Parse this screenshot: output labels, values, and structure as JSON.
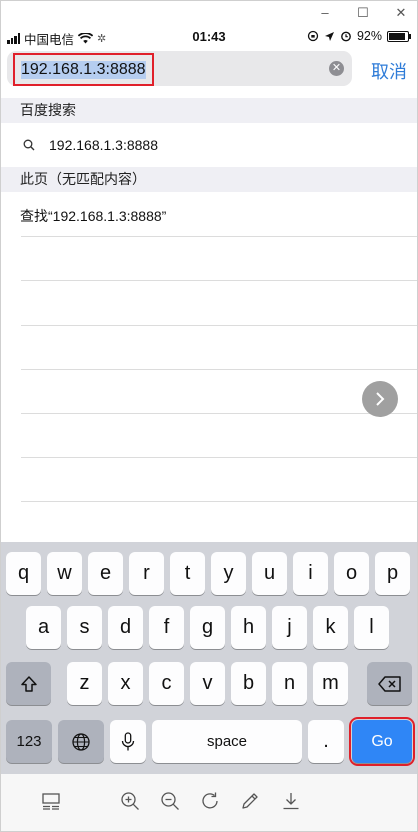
{
  "status_bar": {
    "carrier": "中国电信",
    "time": "01:43",
    "battery": "92%"
  },
  "address_bar": {
    "url": "192.168.1.3:8888",
    "cancel_label": "取消"
  },
  "suggestions": {
    "section_baidu": "百度搜索",
    "baidu_item": "192.168.1.3:8888",
    "section_page": "此页（无匹配内容）",
    "find_item": "查找“192.168.1.3:8888”"
  },
  "keyboard": {
    "row1": [
      "q",
      "w",
      "e",
      "r",
      "t",
      "y",
      "u",
      "i",
      "o",
      "p"
    ],
    "row2": [
      "a",
      "s",
      "d",
      "f",
      "g",
      "h",
      "j",
      "k",
      "l"
    ],
    "row3": [
      "z",
      "x",
      "c",
      "v",
      "b",
      "n",
      "m"
    ],
    "numbers_label": "123",
    "space_label": "space",
    "period_label": ".",
    "go_label": "Go"
  },
  "icons": {
    "window": [
      "minimize-icon",
      "maximize-icon",
      "close-icon"
    ],
    "toolbar": [
      "layout-icon",
      "zoom-in-icon",
      "zoom-out-icon",
      "rotate-icon",
      "edit-icon",
      "download-icon"
    ]
  },
  "colors": {
    "accent": "#2f7cd8",
    "go_key": "#2f86f6",
    "highlight_box": "#e0202a"
  }
}
